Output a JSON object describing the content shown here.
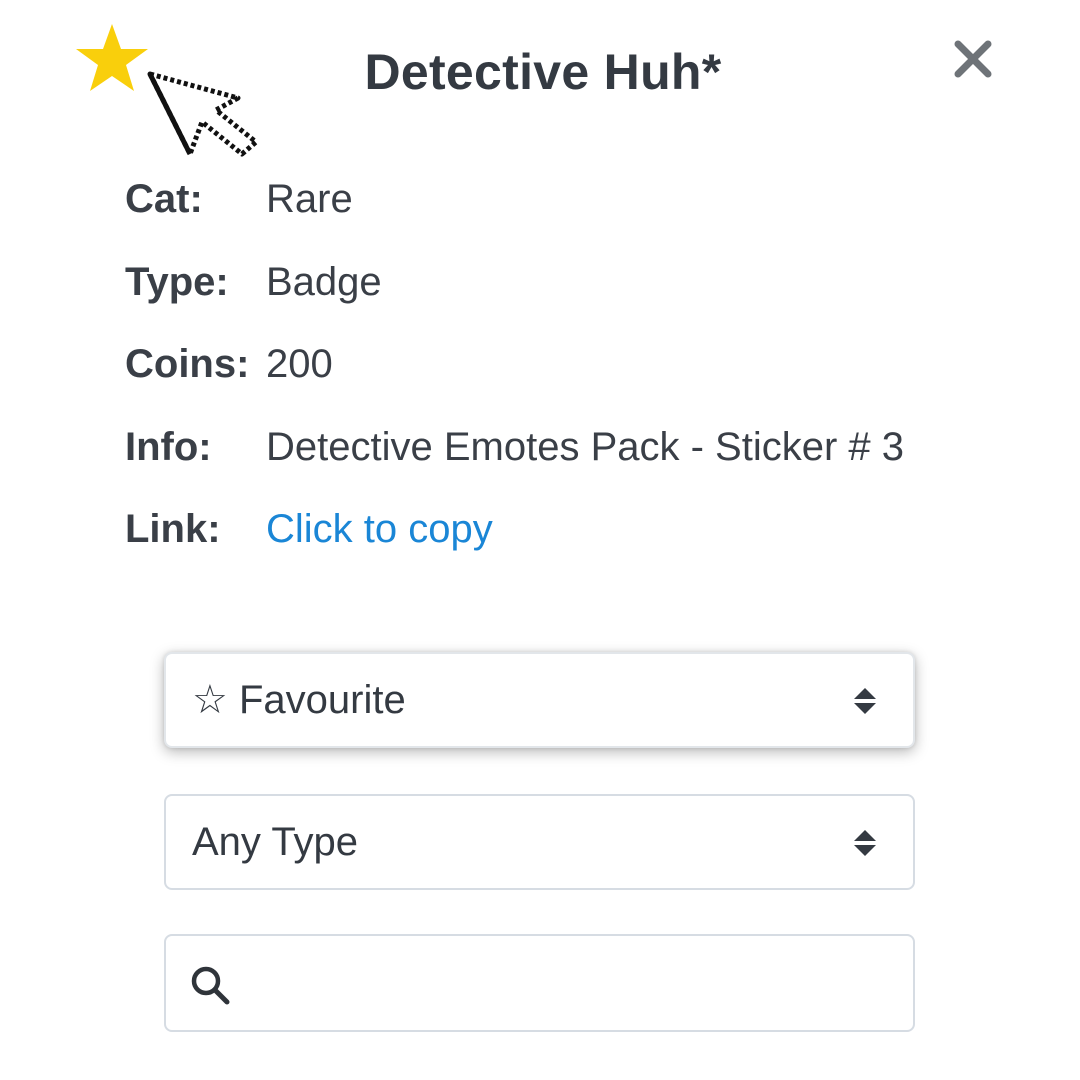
{
  "header": {
    "title": "Detective Huh*",
    "favourite_icon": "star-filled-icon",
    "favourite_color": "#f9cf0c",
    "close_icon": "close-icon"
  },
  "details": [
    {
      "key": "Cat:",
      "value": "Rare"
    },
    {
      "key": "Type:",
      "value": "Badge"
    },
    {
      "key": "Coins:",
      "value": "200"
    },
    {
      "key": "Info:",
      "value": "Detective Emotes Pack - Sticker # 3"
    },
    {
      "key": "Link:",
      "value": "Click to copy",
      "is_link": true
    }
  ],
  "filters": {
    "favourite_select": {
      "icon": "☆",
      "selected": "Favourite"
    },
    "type_select": {
      "selected": "Any Type"
    },
    "search": {
      "value": "",
      "placeholder": "",
      "icon": "search-icon"
    }
  },
  "colors": {
    "link": "#1a86d6",
    "text": "#3a3f47",
    "border": "#d6dce3"
  }
}
